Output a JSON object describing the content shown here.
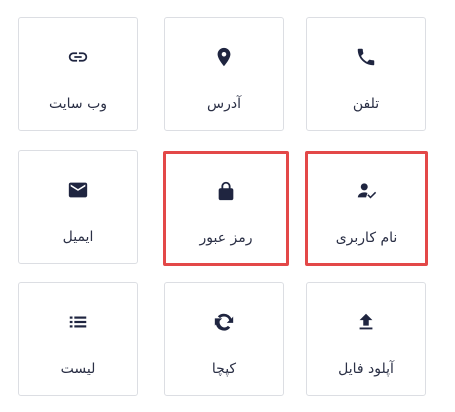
{
  "tiles": [
    {
      "label": "تلفن",
      "icon": "phone-icon"
    },
    {
      "label": "آدرس",
      "icon": "map-pin-icon"
    },
    {
      "label": "وب سایت",
      "icon": "link-icon"
    },
    {
      "label": "نام کاربری",
      "icon": "user-check-icon",
      "selected": true
    },
    {
      "label": "رمز عبور",
      "icon": "lock-icon",
      "selected": true
    },
    {
      "label": "ایمیل",
      "icon": "envelope-icon"
    },
    {
      "label": "آپلود فایل",
      "icon": "upload-icon"
    },
    {
      "label": "کپچا",
      "icon": "recaptcha-icon"
    },
    {
      "label": "لیست",
      "icon": "list-icon"
    }
  ],
  "colors": {
    "selection_border": "#e34848",
    "tile_border": "#dcdee3",
    "icon": "#1f2540",
    "text": "#2a2f45"
  }
}
